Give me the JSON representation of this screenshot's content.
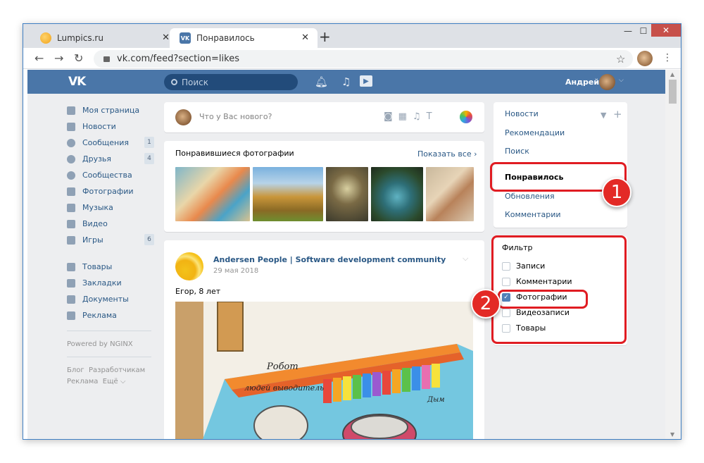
{
  "browser": {
    "tabs": [
      {
        "title": "Lumpics.ru",
        "active": false
      },
      {
        "title": "Понравилось",
        "active": true
      }
    ],
    "new_tab": "+",
    "close": "✕",
    "url": "vk.com/feed?section=likes",
    "controls": {
      "minimize": "—",
      "maximize": "☐",
      "close": "✕"
    }
  },
  "vk_header": {
    "logo": "VK",
    "search_placeholder": "Поиск",
    "user_name": "Андрей"
  },
  "left_nav": {
    "items": [
      {
        "label": "Моя страница",
        "icon": "home-icon"
      },
      {
        "label": "Новости",
        "icon": "news-icon"
      },
      {
        "label": "Сообщения",
        "icon": "messages-icon",
        "count": "1"
      },
      {
        "label": "Друзья",
        "icon": "friends-icon",
        "count": "4"
      },
      {
        "label": "Сообщества",
        "icon": "groups-icon"
      },
      {
        "label": "Фотографии",
        "icon": "camera-icon"
      },
      {
        "label": "Музыка",
        "icon": "music-icon"
      },
      {
        "label": "Видео",
        "icon": "video-icon"
      },
      {
        "label": "Игры",
        "icon": "games-icon",
        "count": "6"
      }
    ],
    "items2": [
      {
        "label": "Товары",
        "icon": "bag-icon"
      },
      {
        "label": "Закладки",
        "icon": "star-icon"
      },
      {
        "label": "Документы",
        "icon": "document-icon"
      },
      {
        "label": "Реклама",
        "icon": "megaphone-icon"
      }
    ],
    "powered": "Powered by NGINX",
    "footer": [
      "Блог",
      "Разработчикам",
      "Реклама",
      "Ещё ⌵"
    ]
  },
  "composer": {
    "placeholder": "Что у Вас нового?"
  },
  "liked_photos": {
    "title": "Понравившиеся фотографии",
    "show_all": "Показать все ›"
  },
  "post": {
    "author": "Andersen People | Software development community",
    "date": "29 мая 2018",
    "text": "Егор, 8 лет",
    "drawing_text_1": "Робот",
    "drawing_text_2": "людей выводитель",
    "drawing_text_3": "Дым"
  },
  "right_nav": {
    "items": [
      "Новости",
      "Рекомендации",
      "Поиск",
      "Понравилось",
      "Обновления",
      "Комментарии"
    ],
    "active": "Понравилось"
  },
  "filter": {
    "title": "Фильтр",
    "options": [
      {
        "label": "Записи",
        "checked": false
      },
      {
        "label": "Комментарии",
        "checked": false
      },
      {
        "label": "Фотографии",
        "checked": true
      },
      {
        "label": "Видеозаписи",
        "checked": false
      },
      {
        "label": "Товары",
        "checked": false
      }
    ]
  },
  "annotations": {
    "badge1": "1",
    "badge2": "2",
    "highlight_color": "#e01c22"
  },
  "colors": {
    "vk_blue": "#4a76a8",
    "link": "#2a5885",
    "background": "#edeef0"
  }
}
